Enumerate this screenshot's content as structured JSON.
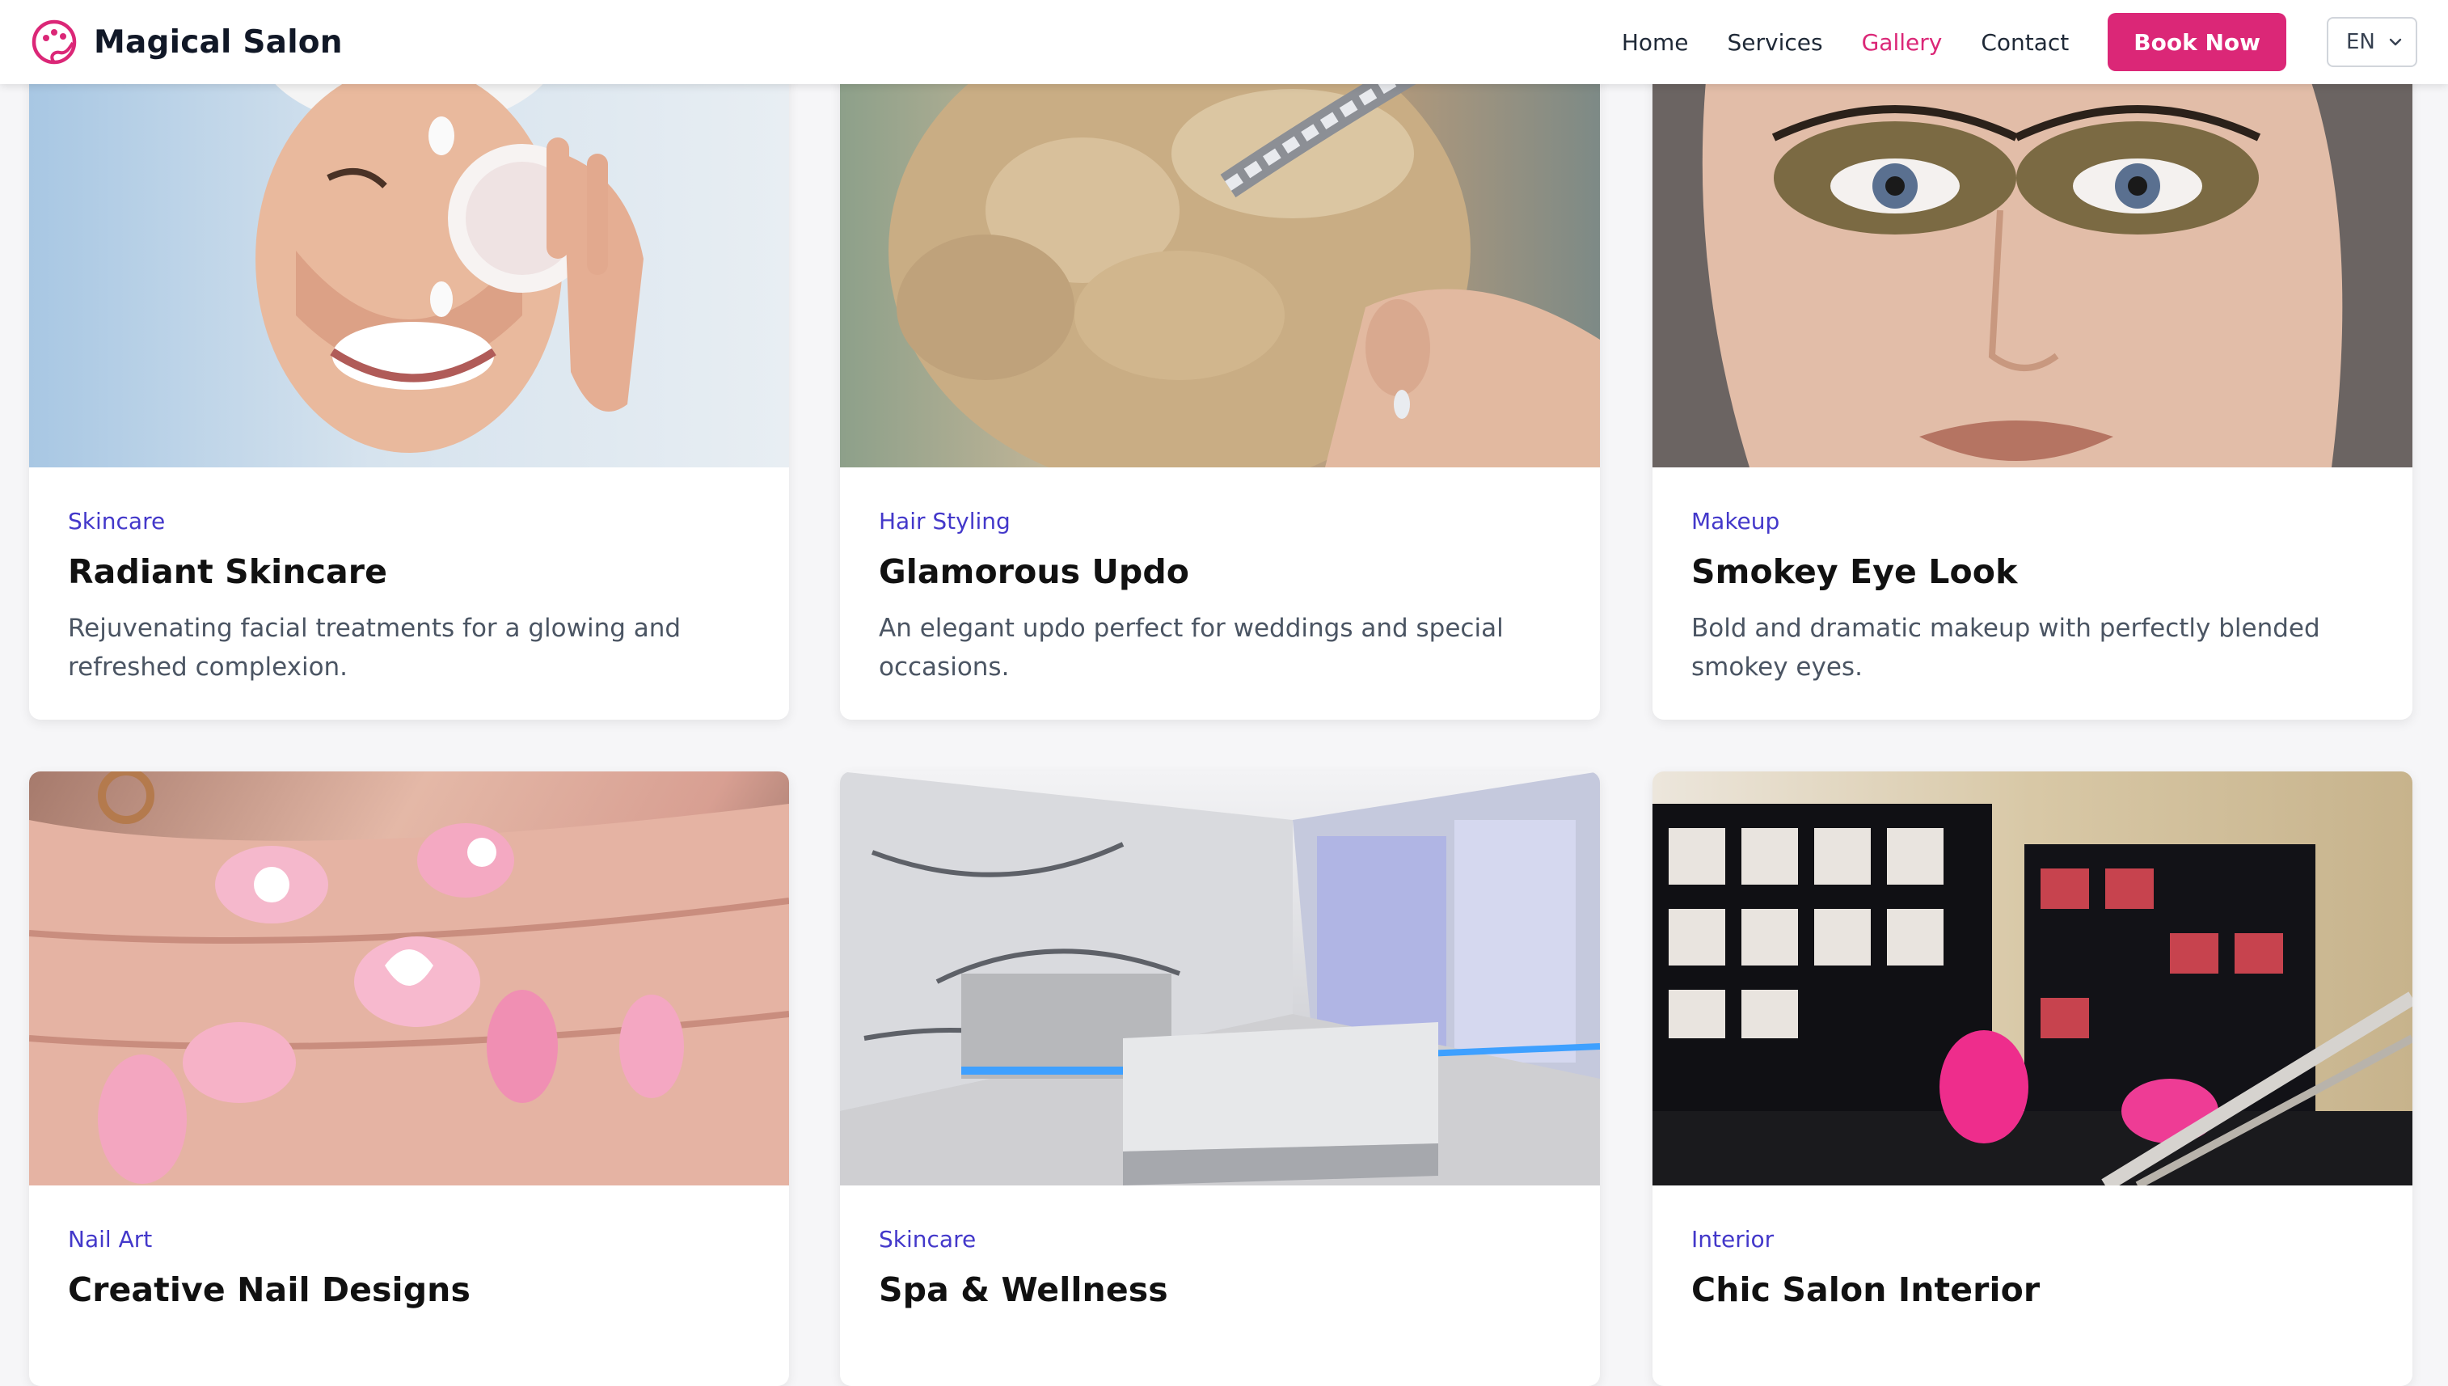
{
  "header": {
    "brand_name": "Magical Salon",
    "nav": {
      "home": "Home",
      "services": "Services",
      "gallery": "Gallery",
      "contact": "Contact"
    },
    "book_label": "Book Now",
    "language": "EN",
    "accent_color": "#db2777"
  },
  "gallery": {
    "items": [
      {
        "category": "Skincare",
        "title": "Radiant Skincare",
        "description": "Rejuvenating facial treatments for a glowing and refreshed complexion."
      },
      {
        "category": "Hair Styling",
        "title": "Glamorous Updo",
        "description": "An elegant updo perfect for weddings and special occasions."
      },
      {
        "category": "Makeup",
        "title": "Smokey Eye Look",
        "description": "Bold and dramatic makeup with perfectly blended smokey eyes."
      },
      {
        "category": "Nail Art",
        "title": "Creative Nail Designs",
        "description": ""
      },
      {
        "category": "Skincare",
        "title": "Spa & Wellness",
        "description": ""
      },
      {
        "category": "Interior",
        "title": "Chic Salon Interior",
        "description": ""
      }
    ]
  },
  "colors": {
    "category": "#4338ca",
    "title": "#111111",
    "description": "#4b5563"
  }
}
